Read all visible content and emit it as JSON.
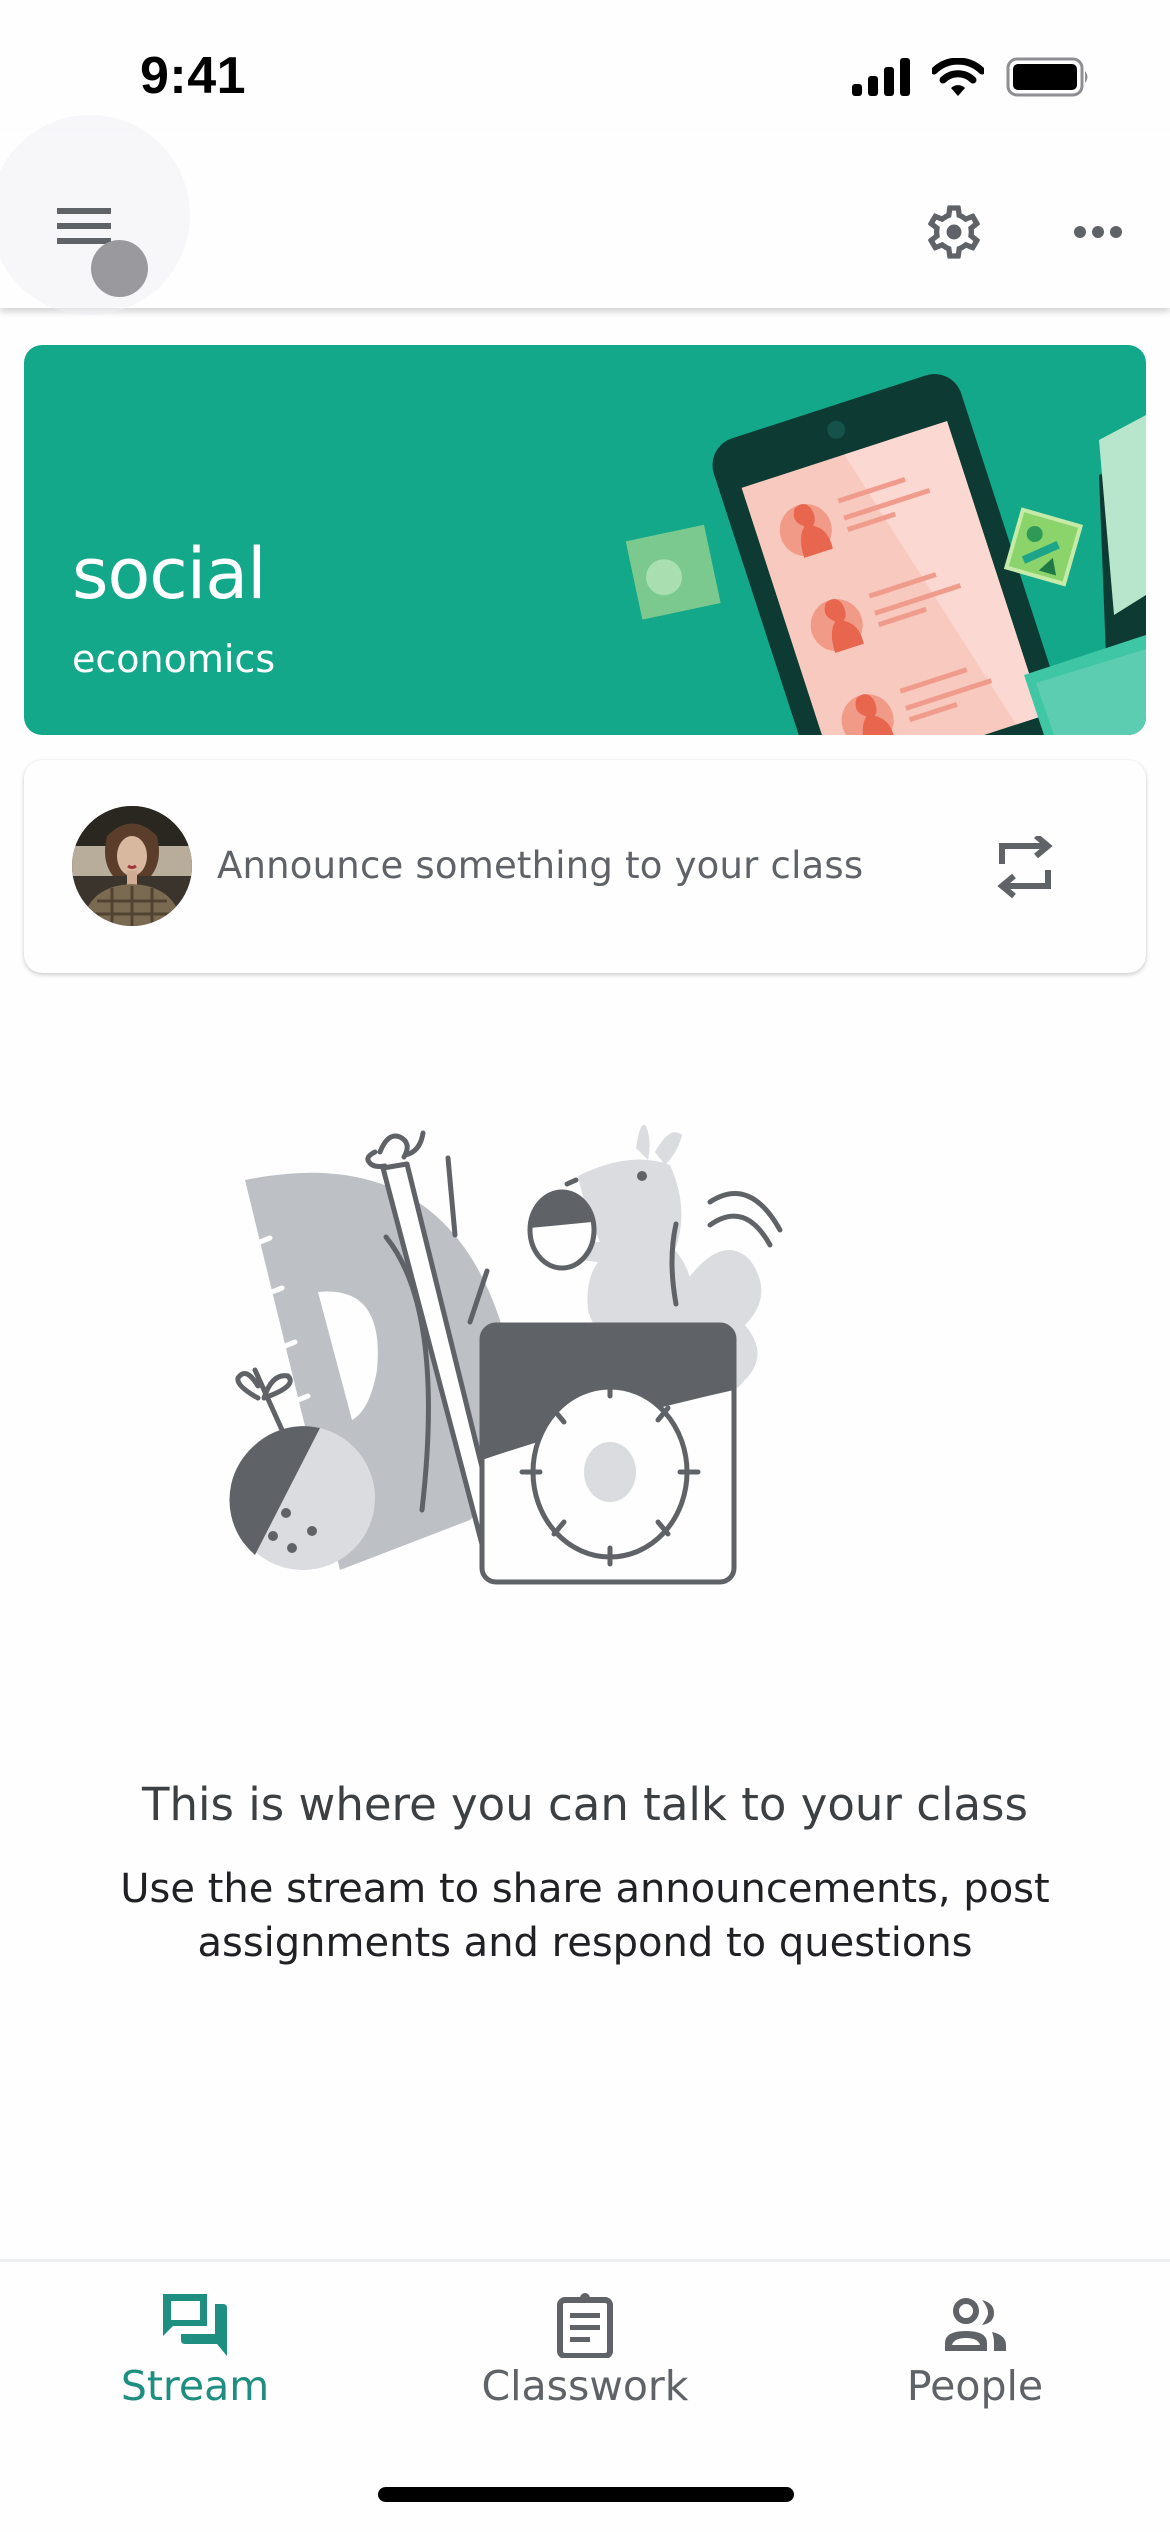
{
  "status_bar": {
    "time": "9:41",
    "icons": [
      "cellular-signal-icon",
      "wifi-icon",
      "battery-icon"
    ]
  },
  "app_bar": {
    "left_icon": "hamburger-menu-icon",
    "right_icons": [
      "gear-icon",
      "more-horizontal-icon"
    ]
  },
  "class_banner": {
    "title": "social",
    "subtitle": "economics",
    "background_color": "#14a88a"
  },
  "announce": {
    "placeholder": "Announce something to your class",
    "avatar": "user-avatar",
    "action_icon": "repost-icon"
  },
  "empty_state": {
    "title": "This is where you can talk to your class",
    "body": "Use the stream to share announcements, post assignments and respond to questions"
  },
  "bottom_nav": {
    "items": [
      {
        "label": "Stream",
        "icon": "stream-icon",
        "active": true
      },
      {
        "label": "Classwork",
        "icon": "clipboard-icon",
        "active": false
      },
      {
        "label": "People",
        "icon": "people-icon",
        "active": false
      }
    ],
    "active_color": "#1e8e80",
    "inactive_color": "#5f6368"
  }
}
